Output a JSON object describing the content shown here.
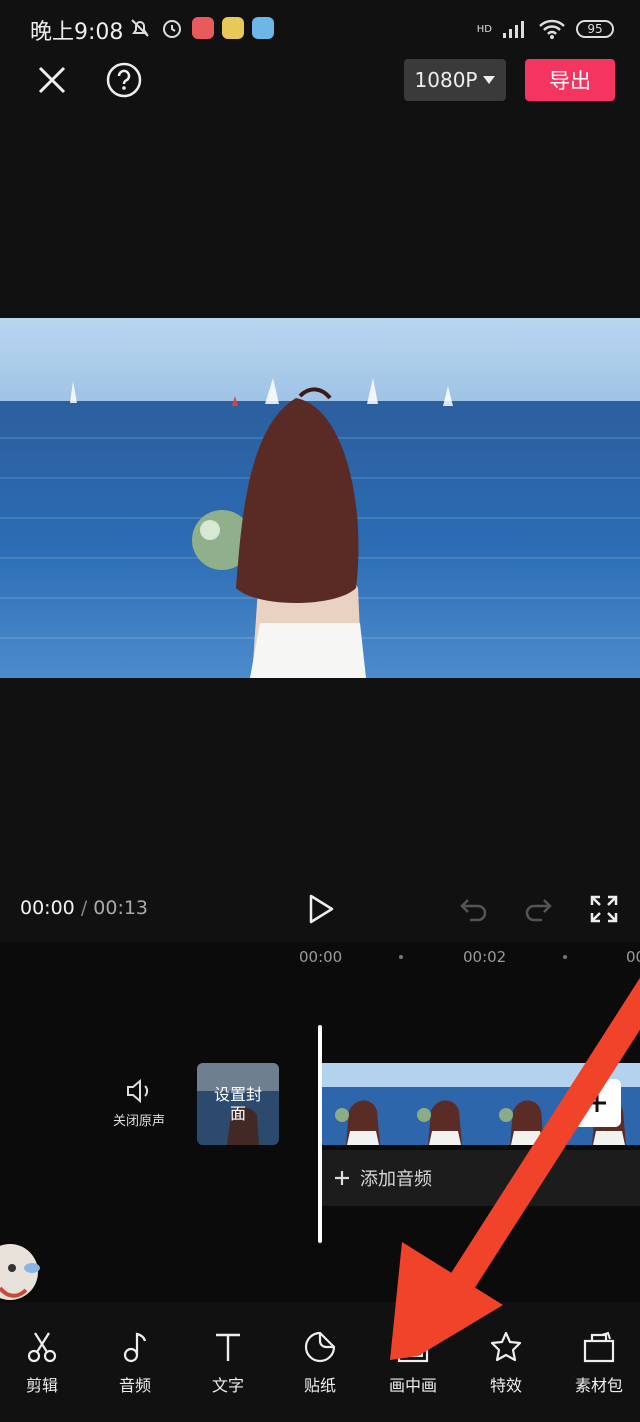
{
  "status_bar": {
    "time": "晚上9:08",
    "battery": "95",
    "network": "HD"
  },
  "top_bar": {
    "resolution": "1080P",
    "export_label": "导出"
  },
  "playback": {
    "current_time": "00:00",
    "separator": "/",
    "total_time": "00:13"
  },
  "timeline": {
    "ticks": [
      "00:00",
      "00:02",
      "00"
    ],
    "mute_label": "关闭原声",
    "cover_label": "设置封面",
    "add_audio_label": "添加音频"
  },
  "toolbar": {
    "items": [
      {
        "label": "剪辑",
        "icon": "scissors-icon"
      },
      {
        "label": "音频",
        "icon": "music-note-icon"
      },
      {
        "label": "文字",
        "icon": "text-icon"
      },
      {
        "label": "贴纸",
        "icon": "sticker-icon"
      },
      {
        "label": "画中画",
        "icon": "picture-in-picture-icon"
      },
      {
        "label": "特效",
        "icon": "star-effect-icon"
      },
      {
        "label": "素材包",
        "icon": "material-pack-icon"
      }
    ]
  },
  "colors": {
    "background": "#111111",
    "export_accent": "#f4355f",
    "annotation_arrow": "#f0432a"
  }
}
